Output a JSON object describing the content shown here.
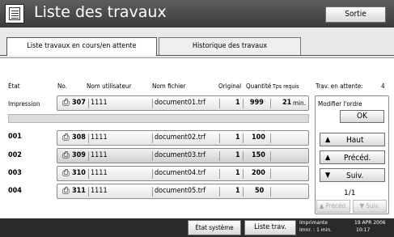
{
  "title": "Liste des travaux",
  "exit_label": "Sortie",
  "tabs": {
    "active": "Liste travaux en cours/en attente",
    "inactive": "Historique des travaux"
  },
  "columns": {
    "etat": "État",
    "no": "No.",
    "user": "Nom utilisateur",
    "file": "Nom fichier",
    "original": "Original",
    "qty": "Quantité",
    "time": "Tps requis"
  },
  "waiting_label": "Trav. en attente:",
  "waiting_count": "4",
  "current_job": {
    "state": "Impression",
    "no": "307",
    "user": "1111",
    "file": "document01.trf",
    "original": "1",
    "qty": "999",
    "time_value": "21",
    "time_unit": "min."
  },
  "jobs": [
    {
      "rank": "001",
      "no": "308",
      "user": "1111",
      "file": "document02.trf",
      "original": "1",
      "qty": "100"
    },
    {
      "rank": "002",
      "no": "309",
      "user": "1111",
      "file": "document03.trf",
      "original": "1",
      "qty": "150"
    },
    {
      "rank": "003",
      "no": "310",
      "user": "1111",
      "file": "document04.trf",
      "original": "1",
      "qty": "200"
    },
    {
      "rank": "004",
      "no": "311",
      "user": "1111",
      "file": "document05.trf",
      "original": "1",
      "qty": "50"
    }
  ],
  "side": {
    "modify_label": "Modifier l'ordre",
    "ok": "OK",
    "haut": "Haut",
    "preced": "Précéd.",
    "suiv": "Suiv.",
    "page": "1/1",
    "prev_page": "Précéd.",
    "next_page": "Suiv."
  },
  "status": {
    "system_button": "État système",
    "jobs_button": "Liste trav.",
    "printer_label": "Imprimante",
    "printer_sub": "Imnr. : 1 min.",
    "date": "19 APR 2006",
    "time": "10:17"
  }
}
